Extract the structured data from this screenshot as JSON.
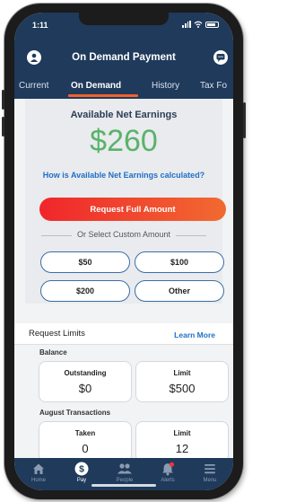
{
  "status_bar": {
    "time": "1:11"
  },
  "header": {
    "title": "On Demand Payment"
  },
  "tabs": [
    {
      "label": "Current"
    },
    {
      "label": "On Demand"
    },
    {
      "label": "History"
    },
    {
      "label": "Tax Fo"
    }
  ],
  "earnings": {
    "label": "Available Net Earnings",
    "value": "$260",
    "how_link": "How is Available Net Earnings calculated?",
    "request_full_label": "Request Full Amount",
    "or_select_label": "Or Select Custom Amount",
    "amounts": [
      "$50",
      "$100",
      "$200",
      "Other"
    ]
  },
  "limits": {
    "title": "Request Limits",
    "learn_more": "Learn More",
    "balance": {
      "label": "Balance",
      "outstanding": {
        "label": "Outstanding",
        "value": "$0"
      },
      "limit": {
        "label": "Limit",
        "value": "$500"
      }
    },
    "transactions": {
      "label": "August Transactions",
      "taken": {
        "label": "Taken",
        "value": "0"
      },
      "limit": {
        "label": "Limit",
        "value": "12"
      }
    }
  },
  "bottom_nav": [
    {
      "label": "Home",
      "icon": "home-icon"
    },
    {
      "label": "Pay",
      "icon": "pay-icon"
    },
    {
      "label": "People",
      "icon": "people-icon"
    },
    {
      "label": "Alerts",
      "icon": "bell-icon"
    },
    {
      "label": "Menu",
      "icon": "menu-icon"
    }
  ],
  "colors": {
    "header_bg": "#1f3a5b",
    "accent_orange": "#f16a30",
    "earnings_green": "#59b36a",
    "link_blue": "#1f6fc7"
  }
}
